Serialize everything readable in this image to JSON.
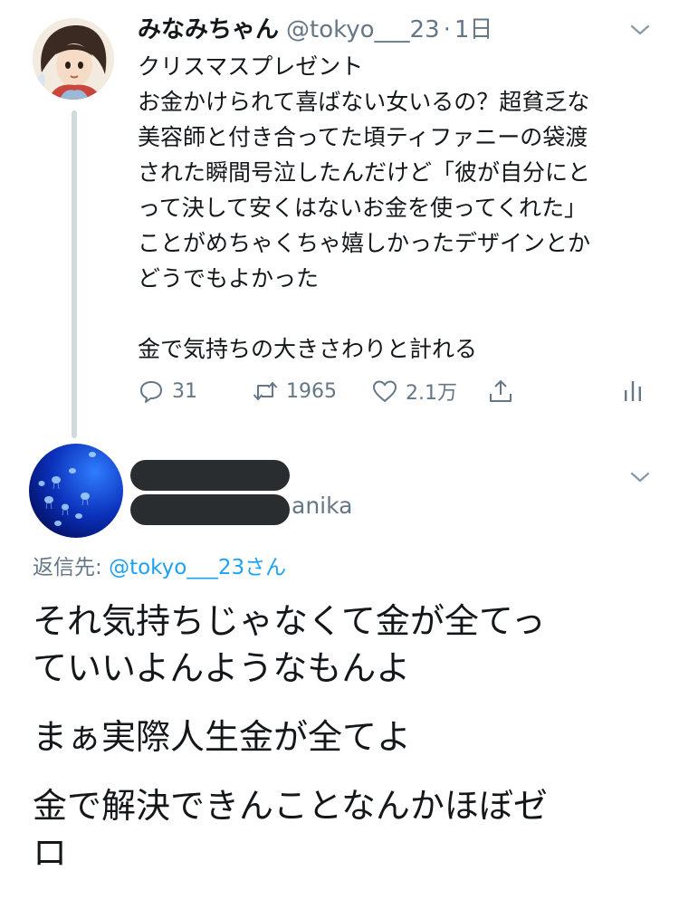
{
  "tweet": {
    "display_name": "みなみちゃん",
    "handle": "@tokyo___23",
    "separator": "·",
    "time": "1日",
    "lines": [
      "クリスマスプレゼント",
      "お金かけられて喜ばない女いるの？超貧乏な",
      "美容師と付き合ってた頃ティファニーの袋渡",
      "された瞬間号泣したんだけど「彼が自分にと",
      "って決して安くはないお金を使ってくれた」",
      "ことがめちゃくちゃ嬉しかったデザインとか",
      "どうでもよかった",
      "",
      "金で気持ちの大きさわりと計れる"
    ],
    "actions": {
      "reply_count": "31",
      "retweet_count": "1965",
      "like_count": "2.1万"
    },
    "icons": {
      "reply": "reply-icon",
      "retweet": "retweet-icon",
      "like": "heart-icon",
      "share": "share-icon",
      "analytics": "analytics-icon",
      "more": "chevron-down-icon"
    }
  },
  "reply": {
    "name_suffix": "anika",
    "reply_to_prefix": "返信先: ",
    "reply_to_mention": "@tokyo___23",
    "reply_to_suffix": "さん",
    "paragraphs": [
      [
        "それ気持ちじゃなくて金が全てっ",
        "ていいよんようなもんよ"
      ],
      [
        "まぁ実際人生金が全てよ"
      ],
      [
        "金で解決できんことなんかほぼゼ",
        "ロ"
      ]
    ]
  },
  "colors": {
    "text": "#14171a",
    "secondary": "#657786",
    "link": "#1da1f2",
    "thread_line": "#cfd9de",
    "redaction": "#2a2d30"
  }
}
